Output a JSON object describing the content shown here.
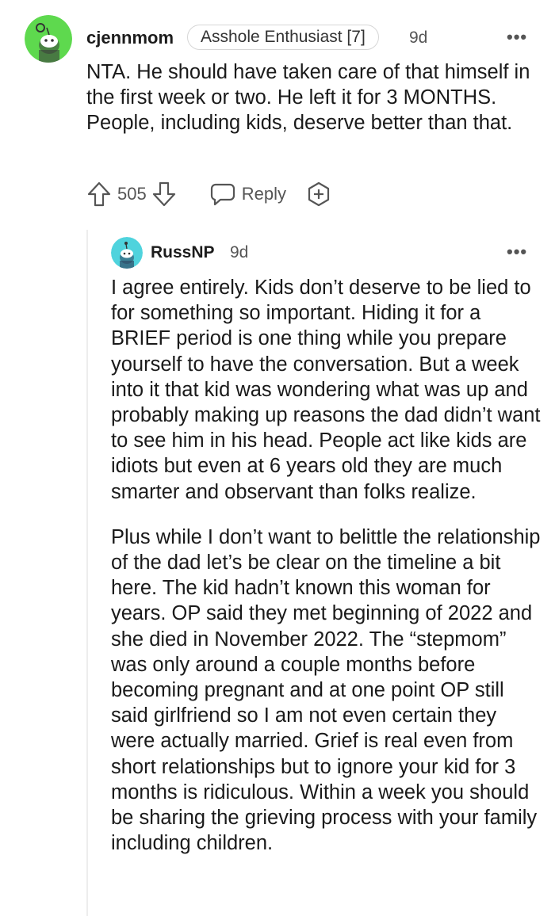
{
  "comment": {
    "username": "cjennmom",
    "flair": "Asshole Enthusiast [7]",
    "age": "9d",
    "more_label": "•••",
    "body": "NTA. He should have taken care of that himself in the first week or two. He left it for 3 MONTHS. People, including kids, deserve better than that.",
    "vote_count": "505",
    "reply_label": "Reply",
    "avatar_color": "#5ed94e"
  },
  "reply": {
    "username": "RussNP",
    "age": "9d",
    "more_label": "•••",
    "avatar_color": "#4fd3dd",
    "paragraphs": [
      "I agree entirely. Kids don’t deserve to be lied to for something so important. Hiding it for a BRIEF period is one thing while you prepare yourself to have the conversation. But a week into it that kid was wondering what was up and probably making up reasons the dad didn’t want to see him in his head. People act like kids are idiots but even at 6 years old they are much smarter and observant than folks realize.",
      "Plus while I don’t want to belittle the relationship of the dad let’s be clear on the timeline a bit here. The kid hadn’t known this woman for years. OP said they met beginning of 2022 and she died in November 2022. The “stepmom” was only around a couple months before becoming pregnant and at one point OP still said girlfriend so I am not even certain they were actually married. Grief is real even from short relationships but to ignore your kid for 3 months is ridiculous. Within a week you should be sharing the grieving process with your family including children."
    ]
  }
}
